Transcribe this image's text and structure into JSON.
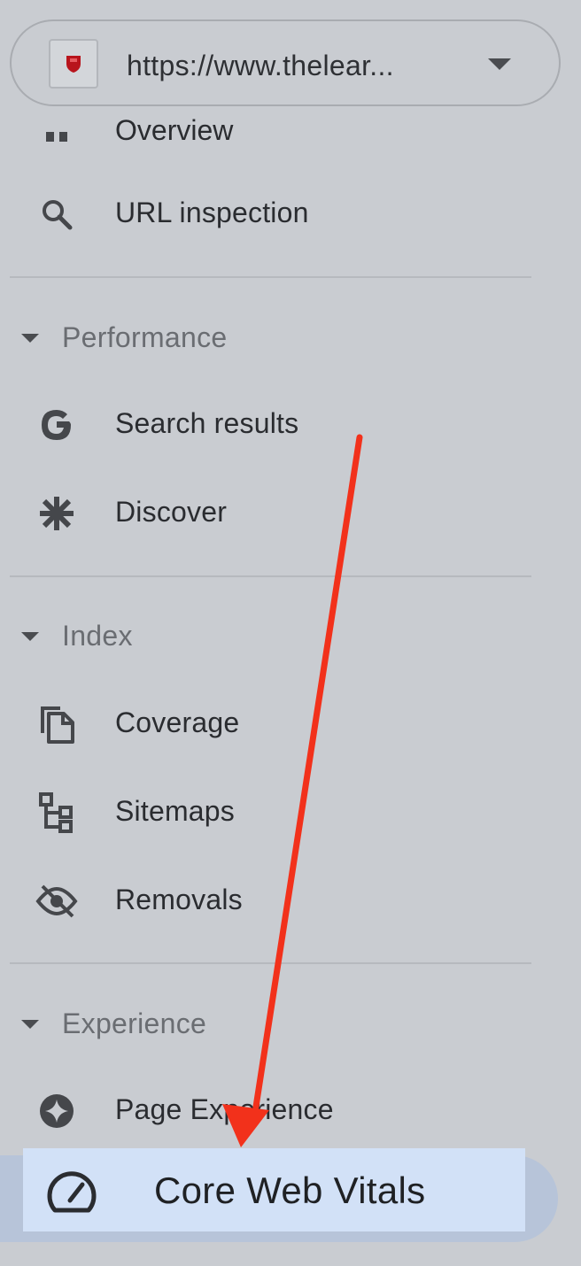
{
  "property": {
    "url": "https://www.thelear...",
    "favicon_icon": "red-shield-favicon",
    "dropdown_icon": "caret-down-icon"
  },
  "nav": {
    "overview": {
      "label": "Overview",
      "icon": "dashboard-icon"
    },
    "url_inspection": {
      "label": "URL inspection",
      "icon": "search-icon"
    },
    "sections": {
      "performance": {
        "label": "Performance",
        "icon": "caret-down-icon"
      },
      "index": {
        "label": "Index",
        "icon": "caret-down-icon"
      },
      "experience": {
        "label": "Experience",
        "icon": "caret-down-icon"
      }
    },
    "items": {
      "search_results": {
        "label": "Search results",
        "icon": "google-g-icon"
      },
      "discover": {
        "label": "Discover",
        "icon": "asterisk-icon"
      },
      "coverage": {
        "label": "Coverage",
        "icon": "copy-pages-icon"
      },
      "sitemaps": {
        "label": "Sitemaps",
        "icon": "sitemap-icon"
      },
      "removals": {
        "label": "Removals",
        "icon": "eye-off-icon"
      },
      "page_experience": {
        "label": "Page Experience",
        "icon": "star-badge-icon"
      },
      "core_web_vitals": {
        "label": "Core Web Vitals",
        "icon": "speedometer-icon"
      }
    }
  },
  "colors": {
    "background": "#c9ccd1",
    "active_highlight": "#d2e1f7",
    "active_pill": "#b7c4d9",
    "annotation_arrow": "#f2311b",
    "section_label": "#6a6d72",
    "item_label": "#2a2c30"
  }
}
